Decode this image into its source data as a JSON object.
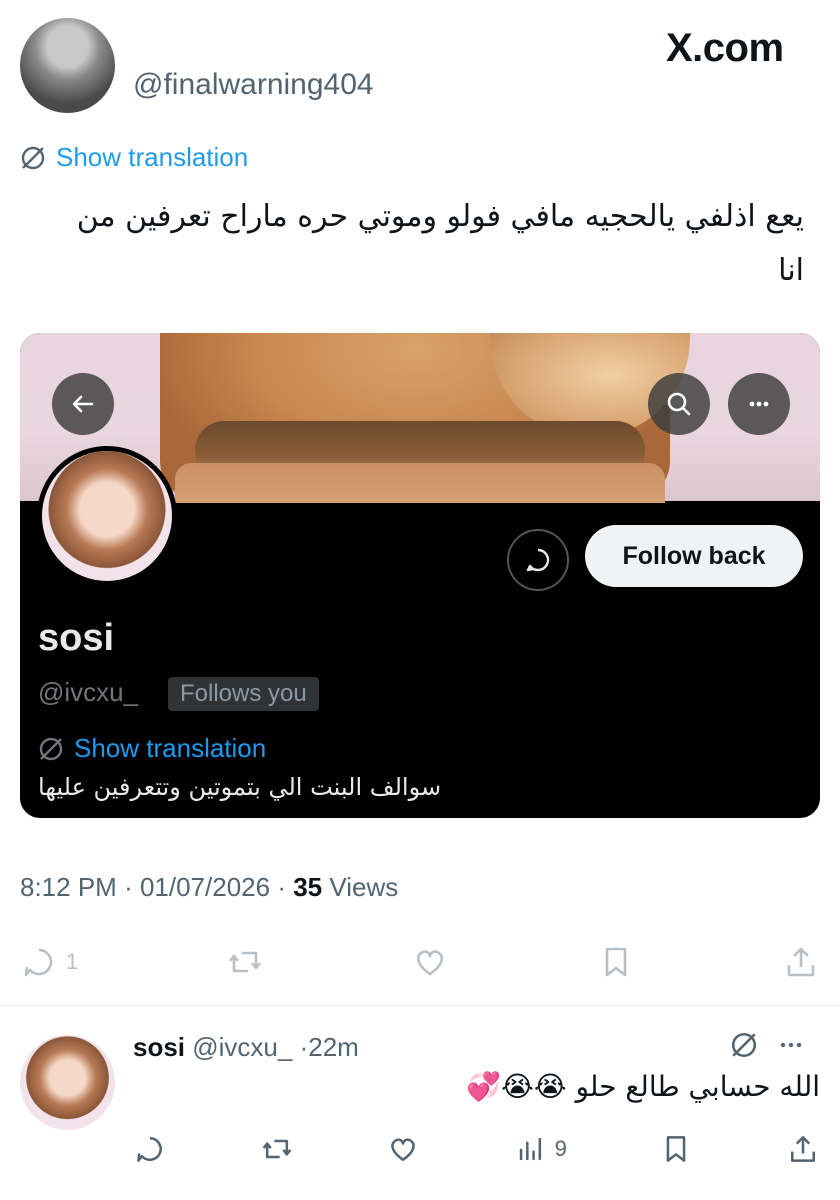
{
  "post": {
    "author_handle": "@finalwarning404",
    "site_label": "X.com",
    "translate_label": "Show translation",
    "text": "يعع اذلفي يالحجيه مافي فولو وموتي حره ماراح تعرفين من انا"
  },
  "card": {
    "name": "sosi",
    "handle": "@ivcxu_",
    "follows_badge": "Follows you",
    "follow_button": "Follow back",
    "translate_label": "Show translation",
    "bio": "سوالف البنت الي بتموتين وتتعرفين عليها"
  },
  "meta": {
    "time": "8:12 PM",
    "date": "01/07/2026",
    "views_count": "35",
    "views_label": "Views"
  },
  "actions": {
    "reply_count": "1"
  },
  "reply": {
    "name": "sosi",
    "handle": "@ivcxu_",
    "age": "22m",
    "text": "الله حسابي طالع حلو 😭😭💞",
    "views_count": "9"
  },
  "colors": {
    "accent": "#1d9bf0",
    "muted": "#536471",
    "card_bg": "#000000",
    "banner_bg": "#e7d4df"
  }
}
